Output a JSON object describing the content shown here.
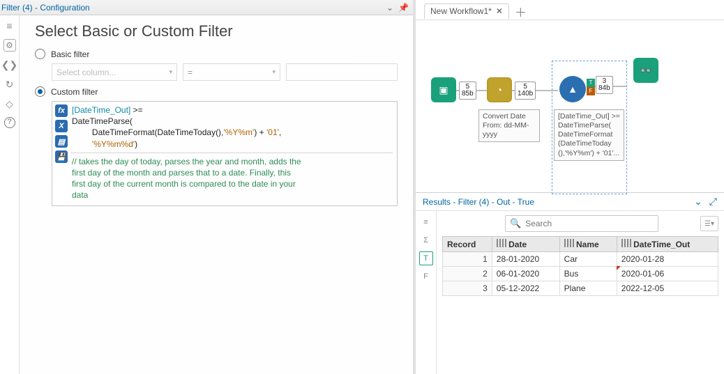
{
  "config": {
    "window_title": "Filter (4) - Configuration",
    "title": "Select Basic or Custom Filter",
    "basic_label": "Basic filter",
    "custom_label": "Custom filter",
    "select_column_placeholder": "Select column...",
    "operator_value": "=",
    "code_line1_bracket": "[DateTime_Out]",
    "code_line1_op": " >=",
    "code_line2": "DateTimeParse(",
    "code_line3_func": "DateTimeFormat(DateTimeToday(),",
    "code_line3_str1": "'%Y%m'",
    "code_line3_mid": ") + ",
    "code_line3_str2": "'01'",
    "code_line3_end": ",",
    "code_line4_str": "'%Y%m%d'",
    "code_line4_end": ")",
    "comment": "// takes the day of today, parses the year and month, adds the\nfirst day of the month and parses that to a date. Finally, this\nfirst day of the current month is compared to the date in your\ndata"
  },
  "workflow": {
    "tab_name": "New Workflow1*",
    "badge1_top": "5",
    "badge1_bot": "85b",
    "badge2_top": "5",
    "badge2_bot": "140b",
    "badge3_top": "3",
    "badge3_bot": "84b",
    "annot_convert": "Convert Date\nFrom:\ndd-MM-yyyy",
    "annot_filter": "[DateTime_Out]\n>=\nDateTimeParse(\nDateTimeFormat\n(DateTimeToday\n(),'%Y%m') +\n'01'..."
  },
  "results": {
    "title": "Results - Filter (4) - Out - True",
    "search_placeholder": "Search",
    "columns": [
      "Record",
      "Date",
      "Name",
      "DateTime_Out"
    ],
    "rows": [
      {
        "record": "1",
        "date": "28-01-2020",
        "name": "Car",
        "dt": "2020-01-28"
      },
      {
        "record": "2",
        "date": "06-01-2020",
        "name": "Bus",
        "dt": "2020-01-06"
      },
      {
        "record": "3",
        "date": "05-12-2022",
        "name": "Plane",
        "dt": "2022-12-05"
      }
    ]
  }
}
